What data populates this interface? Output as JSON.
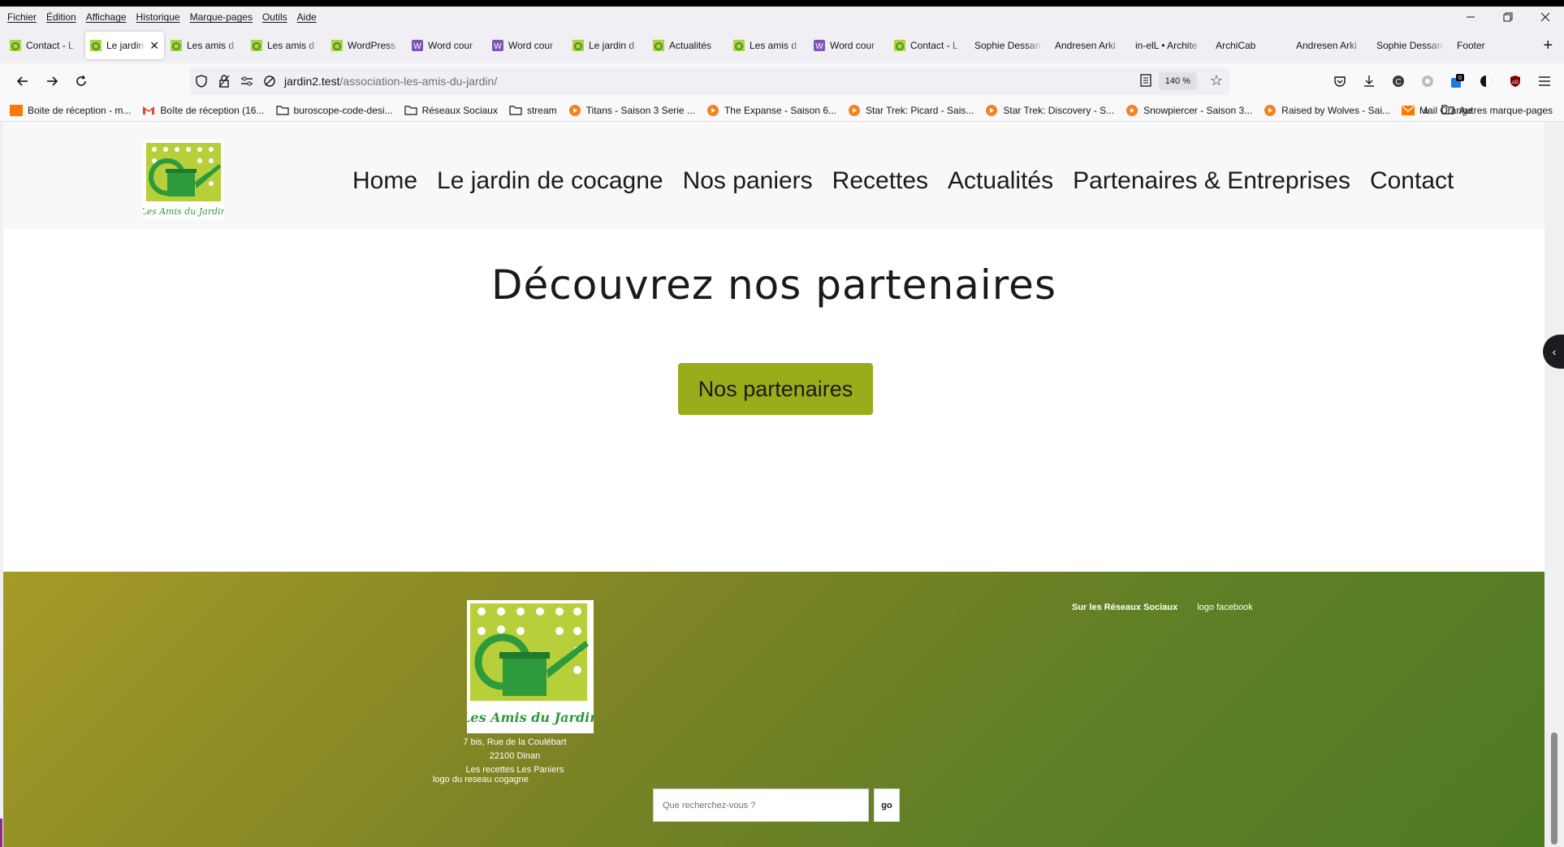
{
  "menubar": {
    "items": [
      "Fichier",
      "Édition",
      "Affichage",
      "Historique",
      "Marque-pages",
      "Outils",
      "Aide"
    ]
  },
  "tabs": [
    {
      "label": "Contact - L",
      "icon": "site-favicon"
    },
    {
      "label": "Le jardin d",
      "icon": "site-favicon",
      "active": true
    },
    {
      "label": "Les amis d",
      "icon": "site-favicon"
    },
    {
      "label": "Les amis d",
      "icon": "site-favicon"
    },
    {
      "label": "WordPress",
      "icon": "site-favicon"
    },
    {
      "label": "Word cour",
      "icon": "woo-favicon"
    },
    {
      "label": "Word cour",
      "icon": "woo-favicon"
    },
    {
      "label": "Le jardin d",
      "icon": "site-favicon"
    },
    {
      "label": "Actualités",
      "icon": "site-favicon"
    },
    {
      "label": "Les amis d",
      "icon": "site-favicon"
    },
    {
      "label": "Word cour",
      "icon": "woo-favicon"
    },
    {
      "label": "Contact - L",
      "icon": "site-favicon"
    },
    {
      "label": "Sophie Dessan",
      "icon": "none"
    },
    {
      "label": "Andresen Arki",
      "icon": "none"
    },
    {
      "label": "in-elL • Archite",
      "icon": "none"
    },
    {
      "label": "ArchiCab",
      "icon": "none"
    },
    {
      "label": "Andresen Arki",
      "icon": "none"
    },
    {
      "label": "Sophie Dessan",
      "icon": "none"
    },
    {
      "label": "Footer",
      "icon": "none"
    }
  ],
  "urlbar": {
    "host": "jardin2.test",
    "path": "/association-les-amis-du-jardin/",
    "zoom": "140 %"
  },
  "bookmarks": [
    {
      "label": "Boite de réception - m...",
      "icon": "mail-orange-icon"
    },
    {
      "label": "Boîte de réception (16...",
      "icon": "gmail-icon"
    },
    {
      "label": "buroscope-code-desi...",
      "icon": "folder-icon"
    },
    {
      "label": "Réseaux Sociaux",
      "icon": "folder-icon"
    },
    {
      "label": "stream",
      "icon": "folder-icon"
    },
    {
      "label": "Titans - Saison 3 Serie ...",
      "icon": "play-icon"
    },
    {
      "label": "The Expanse - Saison 6...",
      "icon": "play-icon"
    },
    {
      "label": "Star Trek: Picard - Sais...",
      "icon": "play-icon"
    },
    {
      "label": "Star Trek: Discovery - S...",
      "icon": "play-icon"
    },
    {
      "label": "Snowpiercer - Saison 3...",
      "icon": "play-icon"
    },
    {
      "label": "Raised by Wolves - Sai...",
      "icon": "play-icon"
    },
    {
      "label": "Mail Orange",
      "icon": "mail-orange-icon"
    }
  ],
  "bookmarks_other": "Autres marque-pages",
  "site": {
    "logo_text": "Les Amis du Jardin",
    "nav": [
      "Home",
      "Le jardin de cocagne",
      "Nos paniers",
      "Recettes",
      "Actualités",
      "Partenaires & Entreprises",
      "Contact"
    ],
    "headline": "Découvrez nos partenaires",
    "cta": "Nos partenaires",
    "colors": {
      "accent": "#9aac1a",
      "brand_green": "#2d9a3c",
      "footer_start": "#a59a26",
      "footer_end": "#4e7a24"
    }
  },
  "footer": {
    "logo_text": "Les Amis du Jardin",
    "address_line1": "7 bis, Rue de la Coulébart",
    "address_line2": "22100 Dinan",
    "links_line": "Les recettes Les Paniers",
    "cogagne_logo_alt": "logo du reseau cogagne",
    "social_title": "Sur les Réseaux Sociaux",
    "facebook_alt": "logo facebook",
    "search_placeholder": "Que recherchez-vous ?",
    "search_button": "go"
  }
}
